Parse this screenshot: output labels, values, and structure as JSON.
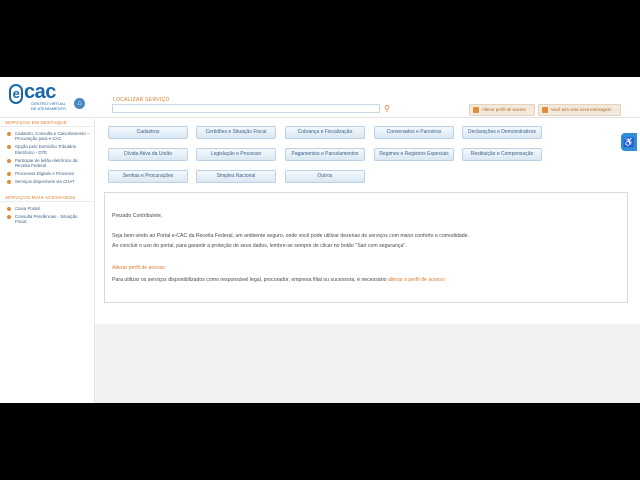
{
  "header": {
    "logo_text": "cac",
    "logo_e": "e",
    "logo_subtitle": "Centro Virtual de Atendimento",
    "search_label": "LOCALIZAR SERVIÇO",
    "search_placeholder": "",
    "profile_button": "Alterar perfil de acesso",
    "messages_button": "Você tem uma nova mensagem"
  },
  "sidebar": {
    "featured_title": "SERVIÇOS EM DESTAQUE",
    "featured": [
      "Cadastro, Consulta e Cancelamento – Procuração para e-CAC",
      "Opção pelo Domicílio Tributário Eletrônico - DTE",
      "Participar de leilão eletrônico da Receita Federal",
      "Processos Digitais e Processo",
      "Serviços disponíveis via CHAT"
    ],
    "accessed_title": "SERVIÇOS MAIS ACESSADOS",
    "accessed": [
      "Caixa Postal",
      "Consulta Pendências - Situação Fiscal"
    ]
  },
  "services": [
    "Cadastros",
    "Certidões e Situação Fiscal",
    "Cobrança e Fiscalização",
    "Convenados e Parceiros",
    "Declarações e Demonstrativos",
    "Dívida Ativa da União",
    "Legislação e Processo",
    "Pagamentos e Parcelamentos",
    "Regimes e Registros Especiais",
    "Restituição e Compensação",
    "Senhas e Procurações",
    "Simples Nacional",
    "Outros"
  ],
  "content": {
    "greeting": "Prezado Contribuinte,",
    "welcome": "Seja bem-vindo ao Portal e-CAC da Receita Federal, um ambiente seguro, onde você pode utilizar dezenas de serviços com maior conforto e comodidade.",
    "logout_note": "Ao concluir o uso do portal, para garantir a proteção de seus dados, lembre-se sempre de clicar no botão \"Sair com segurança\".",
    "profile_title": "Alterar perfil de acesso",
    "profile_text": "Para utilizar os serviços disponibilizados como responsável legal, procurador, empresa filial ou sucessora, é necessário",
    "profile_link": "alterar o perfil de acesso"
  }
}
